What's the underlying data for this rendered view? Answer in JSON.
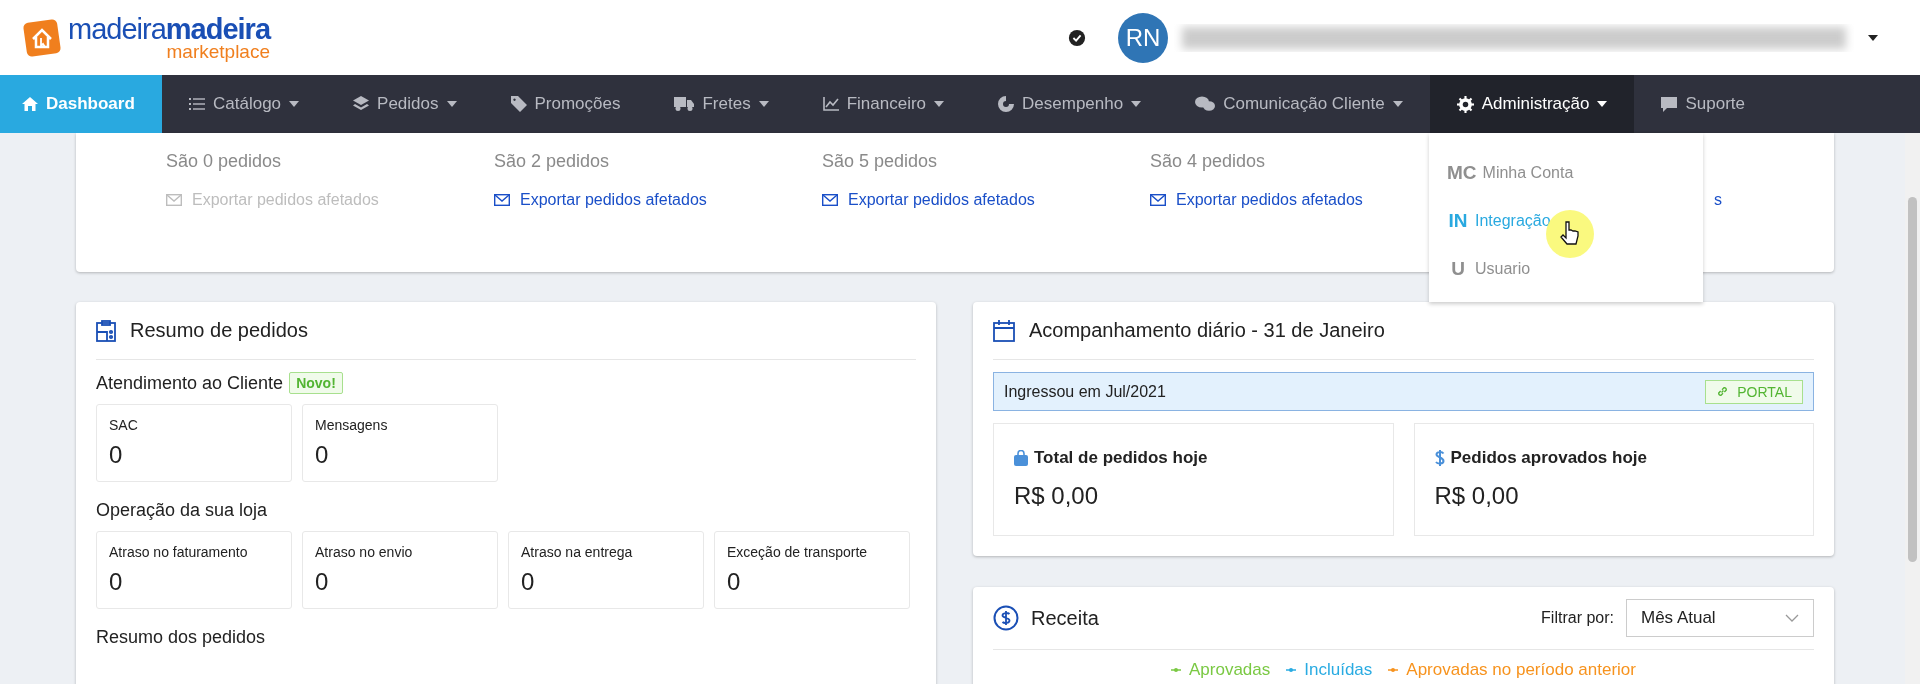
{
  "header": {
    "logo": {
      "part1": "madeira",
      "part2": "madeira",
      "sub": "marketplace"
    },
    "avatar": "RN"
  },
  "nav": [
    {
      "label": "Dashboard",
      "caret": false,
      "selected": true,
      "expanded": false
    },
    {
      "label": "Catálogo",
      "caret": true,
      "selected": false,
      "expanded": false
    },
    {
      "label": "Pedidos",
      "caret": true,
      "selected": false,
      "expanded": false
    },
    {
      "label": "Promoções",
      "caret": false,
      "selected": false,
      "expanded": false
    },
    {
      "label": "Fretes",
      "caret": true,
      "selected": false,
      "expanded": false
    },
    {
      "label": "Financeiro",
      "caret": true,
      "selected": false,
      "expanded": false
    },
    {
      "label": "Desempenho",
      "caret": true,
      "selected": false,
      "expanded": false
    },
    {
      "label": "Comunicação Cliente",
      "caret": true,
      "selected": false,
      "expanded": false
    },
    {
      "label": "Administração",
      "caret": true,
      "selected": false,
      "expanded": true
    },
    {
      "label": "Suporte",
      "caret": false,
      "selected": false,
      "expanded": false
    }
  ],
  "dropdown": [
    {
      "abbr": "MC",
      "label": "Minha Conta",
      "selected": false
    },
    {
      "abbr": "IN",
      "label": "Integração",
      "selected": true
    },
    {
      "abbr": "U",
      "label": "Usuario",
      "selected": false
    }
  ],
  "export_columns": [
    {
      "count": "São 0 pedidos",
      "link": "Exportar pedidos afetados",
      "disabled": true
    },
    {
      "count": "São 2 pedidos",
      "link": "Exportar pedidos afetados",
      "disabled": false
    },
    {
      "count": "São 5 pedidos",
      "link": "Exportar pedidos afetados",
      "disabled": false
    },
    {
      "count": "São 4 pedidos",
      "link": "Exportar pedidos afetados",
      "disabled": false
    },
    {
      "link": "s",
      "disabled": false
    }
  ],
  "orders_summary": {
    "title": "Resumo de pedidos",
    "sections": [
      {
        "title": "Atendimento ao Cliente",
        "badge": "Novo!",
        "tiles": [
          {
            "label": "SAC",
            "value": "0"
          },
          {
            "label": "Mensagens",
            "value": "0"
          }
        ]
      },
      {
        "title": "Operação da sua loja",
        "tiles": [
          {
            "label": "Atraso no faturamento",
            "value": "0"
          },
          {
            "label": "Atraso no envio",
            "value": "0"
          },
          {
            "label": "Atraso na entrega",
            "value": "0"
          },
          {
            "label": "Exceção de transporte",
            "value": "0"
          }
        ]
      },
      {
        "title": "Resumo dos pedidos"
      }
    ]
  },
  "daily": {
    "title": "Acompanhamento diário - 31 de Janeiro",
    "banner": "Ingressou em Jul/2021",
    "portal": "PORTAL",
    "stats": [
      {
        "label": "Total de pedidos hoje",
        "value": "R$ 0,00"
      },
      {
        "label": "Pedidos aprovados hoje",
        "value": "R$ 0,00"
      }
    ]
  },
  "revenue": {
    "title": "Receita",
    "filter_label": "Filtrar por:",
    "filter_value": "Mês Atual",
    "legend": [
      {
        "label": "Aprovadas",
        "color": "#7ac943"
      },
      {
        "label": "Incluídas",
        "color": "#29abe2"
      },
      {
        "label": "Aprovadas no período anterior",
        "color": "#f7931e"
      }
    ]
  }
}
